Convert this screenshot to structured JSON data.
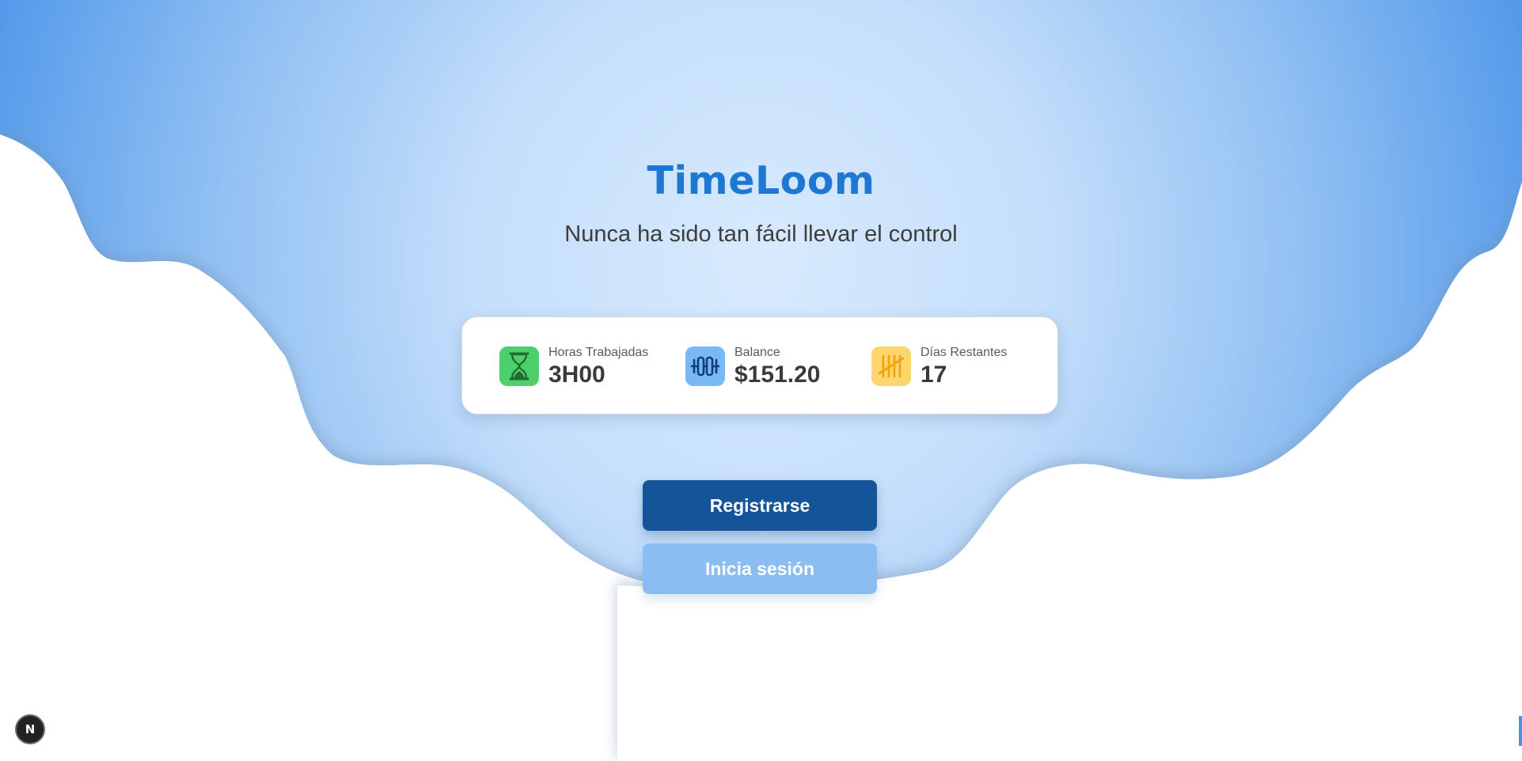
{
  "brand": {
    "title": "TimeLoom",
    "tagline": "Nunca ha sido tan fácil llevar el control"
  },
  "stats": [
    {
      "label": "Horas Trabajadas",
      "value": "3H00",
      "icon": "hourglass-icon",
      "icon_bg": "#4fcf6b",
      "icon_fg": "#1e6e32"
    },
    {
      "label": "Balance",
      "value": "$151.20",
      "icon": "balance-icon",
      "icon_bg": "#7ab8f5",
      "icon_fg": "#0f3f78"
    },
    {
      "label": "Días Restantes",
      "value": "17",
      "icon": "tally-icon",
      "icon_bg": "#ffd66e",
      "icon_fg": "#f2a20b"
    }
  ],
  "actions": {
    "register_label": "Registrarse",
    "login_label": "Inicia sesión"
  },
  "badge": {
    "label": "N",
    "icon": "nextjs-icon"
  },
  "colors": {
    "brand": "#1e78d2",
    "primary_button": "#14559a",
    "secondary_button": "#8bbdf2",
    "sky_center": "#d7e9fd",
    "sky_edge": "#4d98ea"
  }
}
